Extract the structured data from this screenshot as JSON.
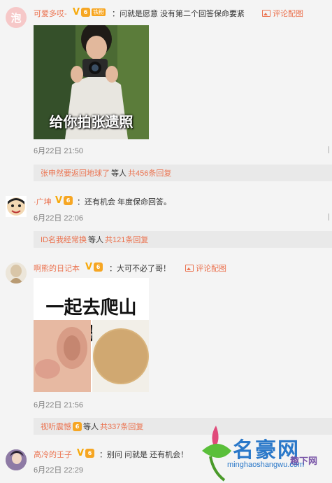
{
  "comments": [
    {
      "username": "可爱多哎-",
      "fan_badge": "铁粉",
      "text": "：问就是愿意 没有第二个回答保命要紧",
      "action": "评论配图",
      "image_caption": "给你拍张遗照",
      "time": "6月22日 21:50",
      "reply": {
        "name": "张申然要返回地球了",
        "mid": "等人",
        "count": "共456条回复"
      }
    },
    {
      "username": "·广坤",
      "text": "：还有机会 年度保命回答。",
      "time": "6月22日 22:06",
      "reply": {
        "name": "ID名我经常换",
        "mid": "等人",
        "count": "共121条回复"
      }
    },
    {
      "username": "啊熊的日记本",
      "text": "：大可不必了哥！",
      "action": "评论配图",
      "image_caption": "一起去爬山吗?",
      "time": "6月22日 21:56",
      "reply": {
        "name": "视听震憾",
        "mid": "等人",
        "count": "共337条回复"
      }
    },
    {
      "username": "高冷的壬子",
      "text": "：别问 问就是 还有机会！",
      "time": "6月22日 22:29"
    }
  ],
  "badges": {
    "v": "V",
    "medal": "6"
  },
  "icons": [
    "image-icon",
    "v-badge-icon",
    "medal-icon",
    "edge-arrow-icon"
  ],
  "watermark": {
    "title": "名豪网",
    "sub": "趣下网",
    "url": "minghaoshangwu.com"
  },
  "colors": {
    "accent": "#eb7350",
    "background": "#f4f4f4",
    "reply_bg": "#e9e9e9",
    "time": "#808080"
  }
}
